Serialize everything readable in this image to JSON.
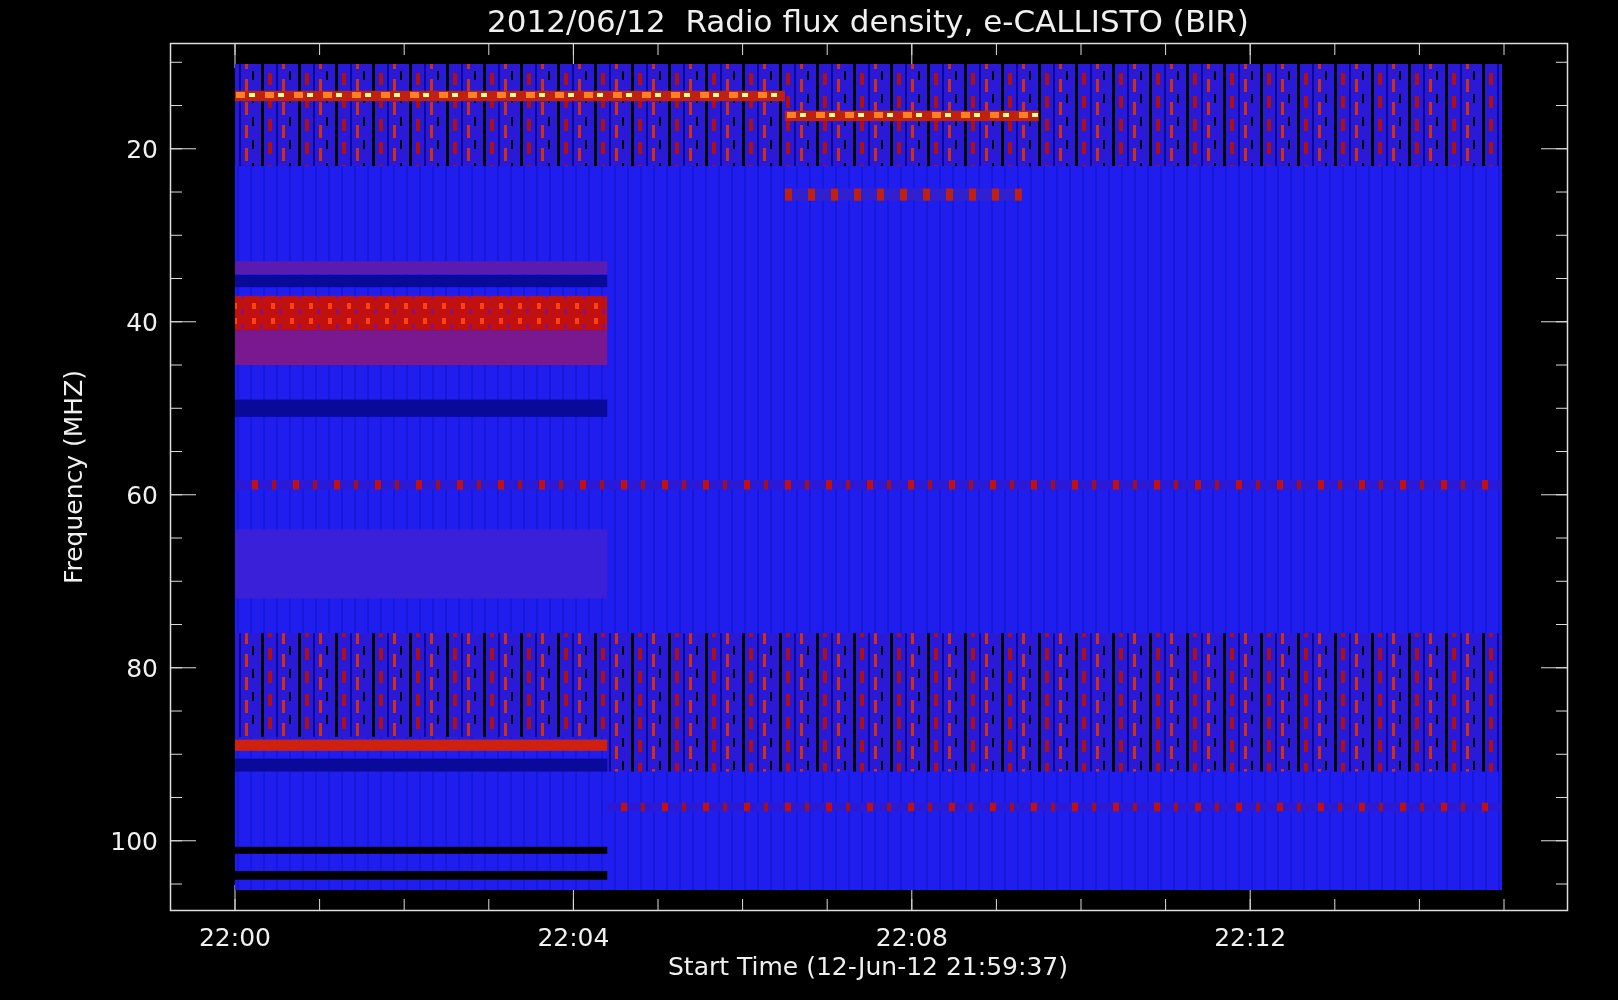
{
  "title": "2012/06/12  Radio flux density, e-CALLISTO (BIR)",
  "x_axis": {
    "label": "Start Time (12-Jun-12 21:59:37)",
    "ticks": [
      "22:00",
      "22:04",
      "22:08",
      "22:12"
    ]
  },
  "y_axis": {
    "label": "Frequency (MHZ)",
    "ticks": [
      "20",
      "40",
      "60",
      "80",
      "100"
    ]
  }
}
